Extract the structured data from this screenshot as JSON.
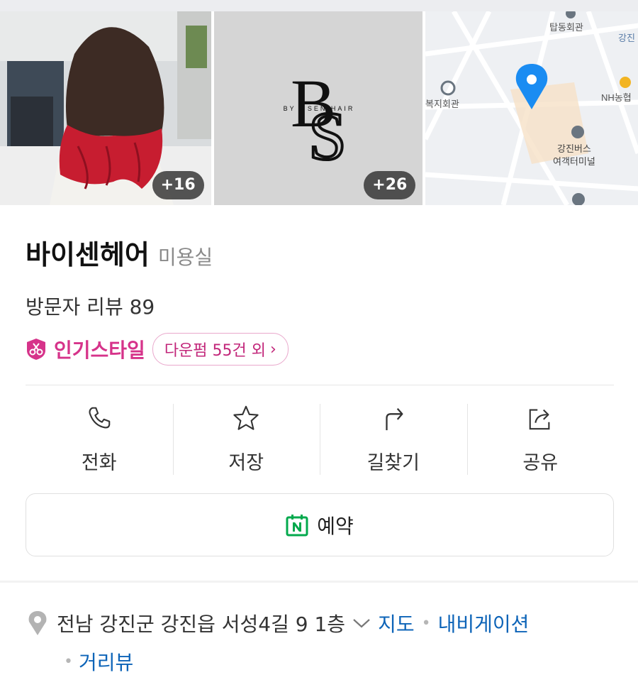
{
  "gallery": {
    "photo1_count": "+16",
    "photo2_count": "+26",
    "logo": {
      "big": "BS",
      "small": "BY . SEN HAIR"
    },
    "map_labels": [
      "탑동회관",
      "강진",
      "NH농협",
      "복지회관",
      "강진버스",
      "여객터미널"
    ]
  },
  "place": {
    "name": "바이센헤어",
    "category": "미용실",
    "reviews": "방문자 리뷰 89",
    "popular_style_label": "인기스타일",
    "popular_style_pill": "다운펌 55건 외"
  },
  "actions": [
    {
      "label": "전화",
      "icon": "phone-icon"
    },
    {
      "label": "저장",
      "icon": "star-icon"
    },
    {
      "label": "길찾기",
      "icon": "directions-icon"
    },
    {
      "label": "공유",
      "icon": "share-icon"
    }
  ],
  "reserve": {
    "label": "예약",
    "icon": "naver-calendar-icon"
  },
  "address": {
    "text": "전남 강진군 강진읍 서성4길 9 1층",
    "map_link": "지도",
    "navi_link": "내비게이션",
    "streetview_link": "거리뷰"
  },
  "colors": {
    "accent_pink": "#d6338a",
    "link_blue": "#0d64b8",
    "naver_green": "#03a94d",
    "map_pin": "#1a8cf2"
  }
}
